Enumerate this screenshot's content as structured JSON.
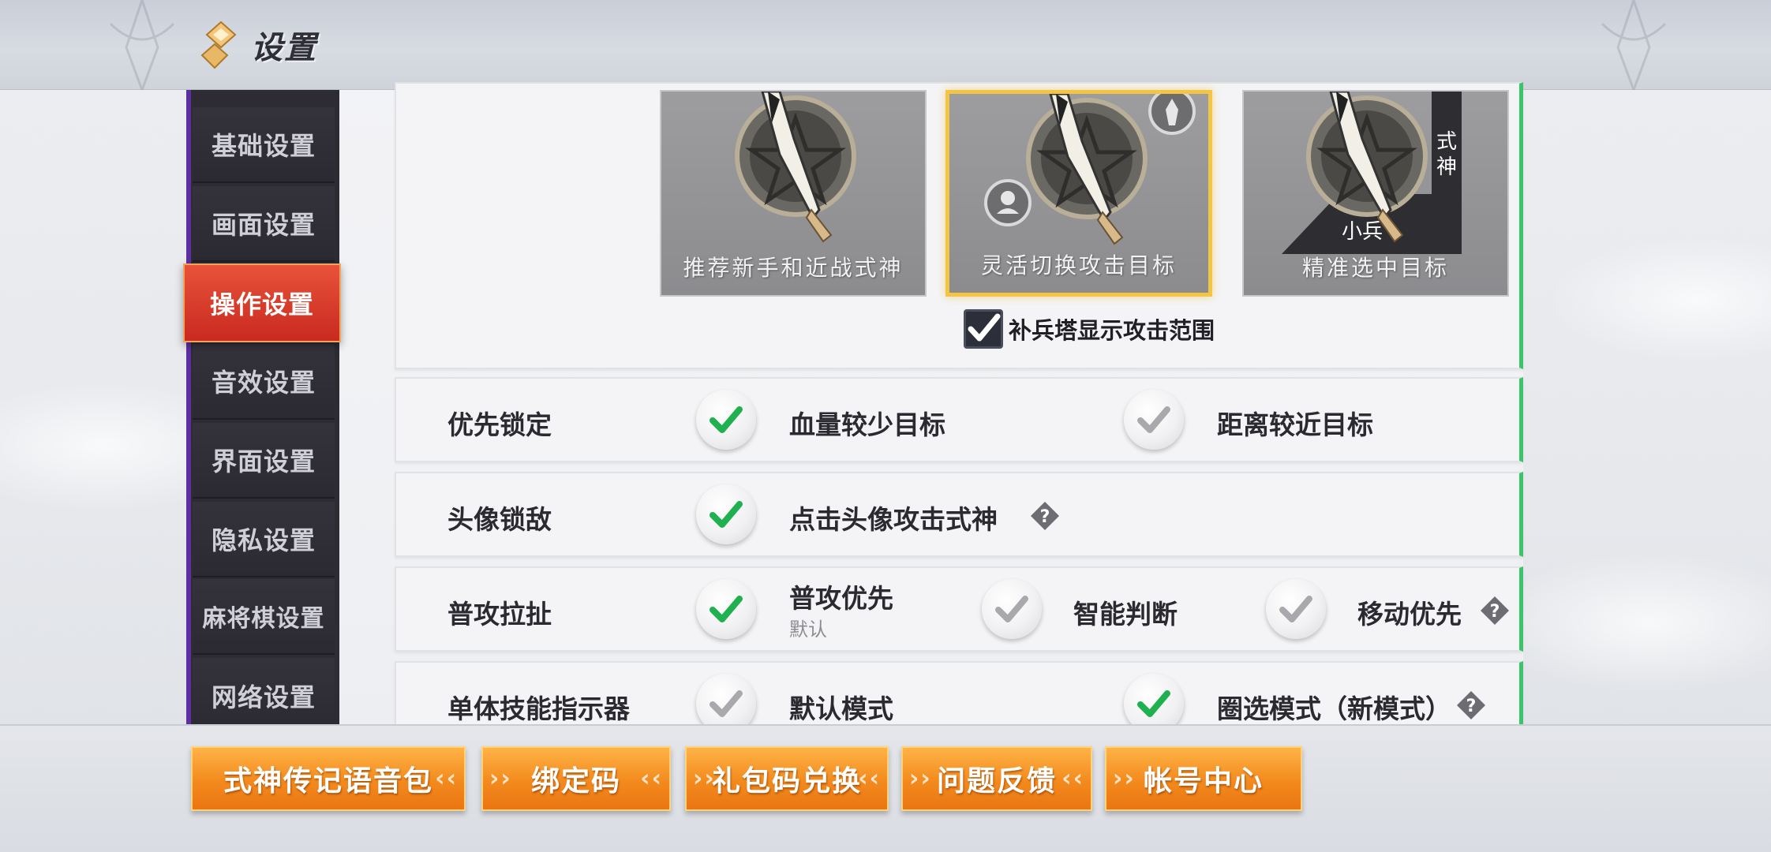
{
  "header": {
    "title": "设置"
  },
  "sidebar": {
    "items": [
      {
        "label": "基础设置"
      },
      {
        "label": "画面设置"
      },
      {
        "label": "操作设置",
        "active": true
      },
      {
        "label": "音效设置"
      },
      {
        "label": "界面设置"
      },
      {
        "label": "隐私设置"
      },
      {
        "label": "麻将棋设置"
      },
      {
        "label": "网络设置"
      }
    ]
  },
  "target_mode": {
    "cards": [
      {
        "label": "推荐新手和近战式神",
        "selected": false
      },
      {
        "label": "灵活切换攻击目标",
        "selected": true
      },
      {
        "label": "精准选中目标",
        "selected": false,
        "art_labels": [
          "式",
          "神",
          "小兵"
        ]
      }
    ],
    "tower_range": {
      "label": "补兵塔显示攻击范围",
      "checked": true
    }
  },
  "rows": {
    "priority_lock": {
      "label": "优先锁定",
      "options": [
        {
          "text": "血量较少目标",
          "checked": true
        },
        {
          "text": "距离较近目标",
          "checked": false
        }
      ]
    },
    "avatar_lock": {
      "label": "头像锁敌",
      "options": [
        {
          "text": "点击头像攻击式神",
          "checked": true
        }
      ]
    },
    "attack_pull": {
      "label": "普攻拉扯",
      "options": [
        {
          "text": "普攻优先",
          "sub": "默认",
          "checked": true
        },
        {
          "text": "智能判断",
          "checked": false
        },
        {
          "text": "移动优先",
          "checked": false
        }
      ]
    },
    "skill_indicator": {
      "label": "单体技能指示器",
      "options": [
        {
          "text": "默认模式",
          "checked": false
        },
        {
          "text": "圈选模式（新模式）",
          "checked": true
        }
      ]
    }
  },
  "bottom_buttons": [
    {
      "label": "式神传记语音包"
    },
    {
      "label": "绑定码"
    },
    {
      "label": "礼包码兑换"
    },
    {
      "label": "问题反馈"
    },
    {
      "label": "帐号中心"
    }
  ],
  "colors": {
    "accent_check": "#1fb14f",
    "inactive_check": "#a9a9ad",
    "active_tab": "#d8371f",
    "button_orange": "#f38a1d",
    "selected_card_border": "#f3c545"
  },
  "icons": [
    "diamond-logo-icon",
    "check-icon",
    "help-icon",
    "chevron-right-icon",
    "chevron-left-icon",
    "pentagram-blade-icon"
  ]
}
